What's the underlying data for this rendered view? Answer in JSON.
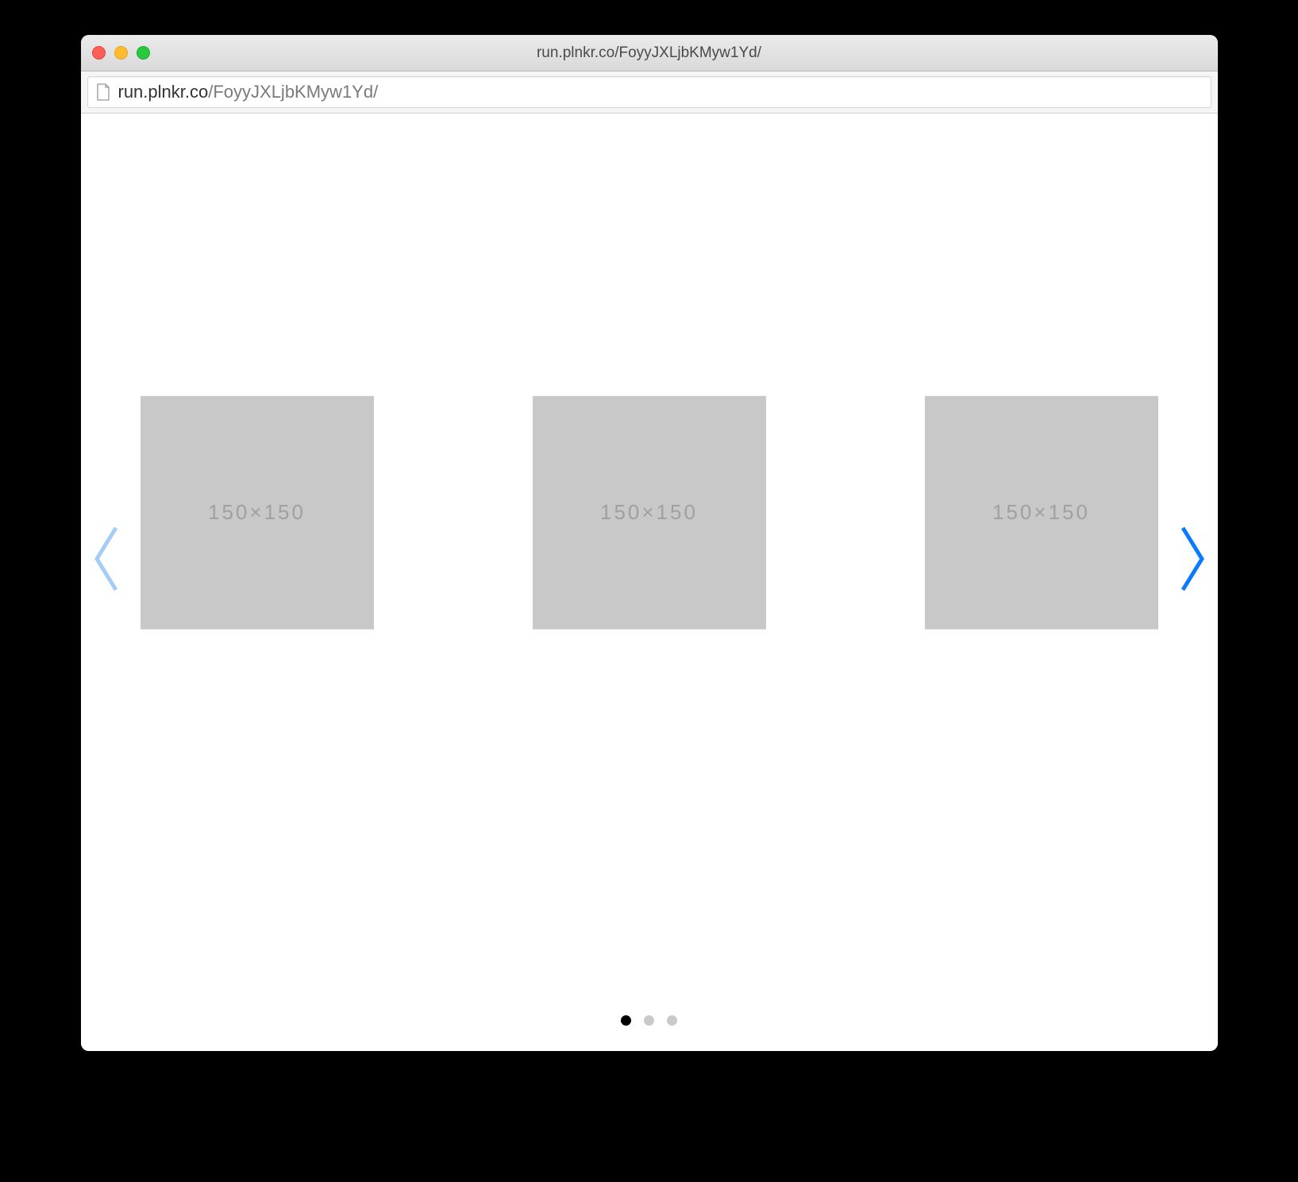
{
  "window": {
    "title": "run.plnkr.co/FoyyJXLjbKMyw1Yd/"
  },
  "address_bar": {
    "host": "run.plnkr.co",
    "path": "/FoyyJXLjbKMyw1Yd/"
  },
  "carousel": {
    "slides": [
      {
        "label": "150×150"
      },
      {
        "label": "150×150"
      },
      {
        "label": "150×150"
      }
    ],
    "active_page_index": 0,
    "page_count": 3,
    "prev_disabled": true,
    "next_disabled": false
  },
  "colors": {
    "arrow_active": "#0a7aff",
    "arrow_disabled": "#a3cdf7",
    "placeholder_bg": "#c8c8c8",
    "placeholder_text": "#a0a0a0",
    "dot_active": "#000000",
    "dot_inactive": "#c9c9c9"
  }
}
